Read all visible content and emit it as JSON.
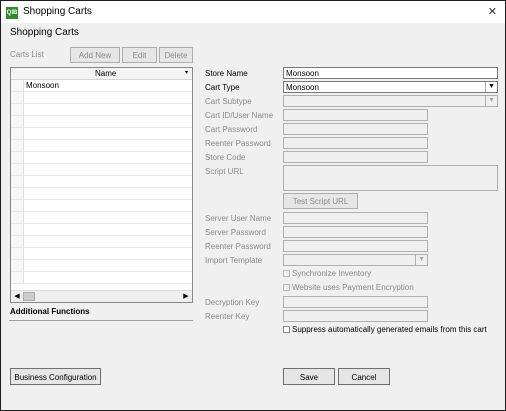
{
  "window": {
    "title": "Shopping Carts",
    "app_icon": "QIB",
    "close_glyph": "✕"
  },
  "heading": "Shopping Carts",
  "carts_list": {
    "label": "Carts List",
    "add_new": "Add New",
    "edit": "Edit",
    "delete": "Delete",
    "column_header": "Name",
    "rows": [
      "Monsoon"
    ],
    "scroll_left": "◀",
    "scroll_right": "▶"
  },
  "additional_functions": "Additional Functions",
  "form": {
    "store_name": {
      "label": "Store Name",
      "value": "Monsoon"
    },
    "cart_type": {
      "label": "Cart Type",
      "value": "Monsoon"
    },
    "cart_subtype": {
      "label": "Cart Subtype",
      "value": ""
    },
    "cart_id": {
      "label": "Cart ID/User Name",
      "value": ""
    },
    "cart_password": {
      "label": "Cart Password",
      "value": ""
    },
    "reenter_password": {
      "label": "Reenter Password",
      "value": ""
    },
    "store_code": {
      "label": "Store Code",
      "value": ""
    },
    "script_url": {
      "label": "Script URL",
      "value": ""
    },
    "test_script_url": "Test Script URL",
    "server_user_name": {
      "label": "Server User Name",
      "value": ""
    },
    "server_password": {
      "label": "Server Password",
      "value": ""
    },
    "reenter_server_password": {
      "label": "Reenter Password",
      "value": ""
    },
    "import_template": {
      "label": "Import Template",
      "value": ""
    },
    "synchronize_inventory": "Synchronize Inventory",
    "payment_encryption": "Website uses Payment Encryption",
    "decryption_key": {
      "label": "Decryption Key",
      "value": ""
    },
    "reenter_key": {
      "label": "Reenter Key",
      "value": ""
    },
    "suppress_emails": "Suppress automatically generated emails from this cart"
  },
  "footer": {
    "business_configuration": "Business Configuration",
    "save": "Save",
    "cancel": "Cancel"
  }
}
